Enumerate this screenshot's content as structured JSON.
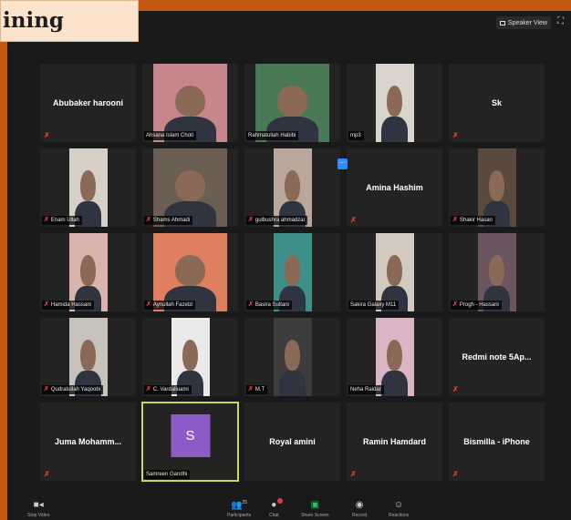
{
  "banner": {
    "text": "ining"
  },
  "top_bar": {
    "speaker_view_label": "Speaker View"
  },
  "participants": [
    {
      "name": "Abubaker harooni",
      "video": false,
      "muted": true
    },
    {
      "name": "Ahsana Islam Choti",
      "video": true,
      "muted": false,
      "bg": "#c9858c"
    },
    {
      "name": "Rahmatullah Habibi",
      "video": true,
      "muted": false,
      "bg": "#4a7a55"
    },
    {
      "name": "mp3",
      "video": true,
      "muted": false,
      "bg": "#d9d4cc"
    },
    {
      "name": "Sk",
      "video": false,
      "muted": true
    },
    {
      "name": "Enam Ullah",
      "video": true,
      "muted": true,
      "bg": "#d6d0c9"
    },
    {
      "name": "Shams Ahmadi",
      "video": true,
      "muted": true,
      "bg": "#6b5e52"
    },
    {
      "name": "gulbushra ahmadzai",
      "video": true,
      "muted": true,
      "bg": "#b8a79a"
    },
    {
      "name": "Amina Hashim",
      "video": false,
      "muted": true
    },
    {
      "name": "Shakir Hasan",
      "video": true,
      "muted": true,
      "bg": "#5a4a3e"
    },
    {
      "name": "Hamida Hassani",
      "video": true,
      "muted": true,
      "bg": "#d9b3ad"
    },
    {
      "name": "Aynullah Fazelzi",
      "video": true,
      "muted": true,
      "bg": "#e07f60"
    },
    {
      "name": "Basira Sultani",
      "video": true,
      "muted": true,
      "bg": "#3e8e8a"
    },
    {
      "name": "Sakira Galaxy M11",
      "video": true,
      "muted": false,
      "bg": "#d2c9bf"
    },
    {
      "name": "Progh - Hassani",
      "video": true,
      "muted": true,
      "bg": "#6a5560"
    },
    {
      "name": "Qudratullah Yaqoobi",
      "video": true,
      "muted": true,
      "bg": "#c7c2bb"
    },
    {
      "name": "C. Vardaliuami",
      "video": true,
      "muted": true,
      "bg": "#eaeaea"
    },
    {
      "name": "M.T",
      "video": true,
      "muted": true,
      "bg": "#3d3d3d"
    },
    {
      "name": "Neha Raidar",
      "video": true,
      "muted": false,
      "bg": "#d9b5c5"
    },
    {
      "name": "Redmi note 5Ap...",
      "video": false,
      "muted": true
    },
    {
      "name": "Juma  Mohamm...",
      "video": false,
      "muted": true
    },
    {
      "name": "Samreen Gandhi",
      "video": false,
      "avatar_letter": "S",
      "muted": false,
      "active": true
    },
    {
      "name": "Royal amini",
      "video": false,
      "muted": false
    },
    {
      "name": "Ramin Hamdard",
      "video": false,
      "muted": true
    },
    {
      "name": "Bismilla - iPhone",
      "video": false,
      "muted": true
    }
  ],
  "toolbar": {
    "stop_video": "Stop Video",
    "participants": "Participants",
    "participants_count": "25",
    "chat": "Chat",
    "share_screen": "Share Screen",
    "record": "Record",
    "reactions": "Reactions"
  },
  "colors": {
    "outer_bg": "#c45a10",
    "active_border": "#c8d85a",
    "muted_red": "#e23b3b",
    "avatar_purple": "#8b5cc5",
    "share_green": "#22c55e"
  }
}
